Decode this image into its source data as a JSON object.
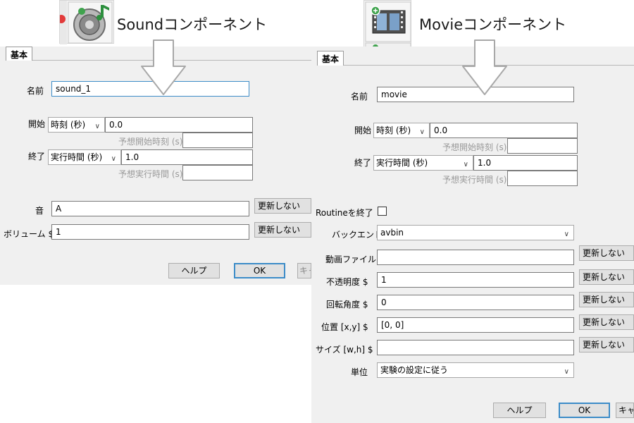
{
  "sound": {
    "title": "Soundコンポーネント",
    "tab": "基本",
    "name_label": "名前",
    "name_value": "sound_1",
    "start_label": "開始",
    "start_type": "時刻 (秒)",
    "start_value": "0.0",
    "expected_start_label": "予想開始時刻 (s)",
    "stop_label": "終了",
    "stop_type": "実行時間 (秒)",
    "stop_value": "1.0",
    "expected_duration_label": "予想実行時間 (s)",
    "sound_label": "音",
    "sound_value": "A",
    "sound_update": "更新しない",
    "volume_label": "ボリューム $",
    "volume_value": "1",
    "volume_update": "更新しない",
    "help_button": "ヘルプ",
    "ok_button": "OK",
    "cancel_button": "キャ"
  },
  "movie": {
    "title": "Movieコンポーネント",
    "tab": "基本",
    "name_label": "名前",
    "name_value": "movie",
    "start_label": "開始",
    "start_type": "時刻 (秒)",
    "start_value": "0.0",
    "expected_start_label": "予想開始時刻 (s)",
    "stop_label": "終了",
    "stop_type": "実行時間 (秒)",
    "stop_value": "1.0",
    "expected_duration_label": "予想実行時間 (s)",
    "force_end_label": "Routineを終了",
    "backend_label": "バックエンド",
    "backend_value": "avbin",
    "movie_file_label": "動画ファイル",
    "movie_file_value": "",
    "movie_file_update": "更新しない",
    "opacity_label": "不透明度 $",
    "opacity_value": "1",
    "opacity_update": "更新しない",
    "orientation_label": "回転角度 $",
    "orientation_value": "0",
    "orientation_update": "更新しない",
    "position_label": "位置 [x,y] $",
    "position_value": "[0, 0]",
    "position_update": "更新しない",
    "size_label": "サイズ [w,h] $",
    "size_value": "",
    "size_update": "更新しない",
    "units_label": "単位",
    "units_value": "実験の設定に従う",
    "help_button": "ヘルプ",
    "ok_button": "OK",
    "cancel_button": "キャ"
  },
  "colors": {
    "panel_bg": "#f0f0f0",
    "focus_border": "#3c8cc8",
    "button_bg": "#e1e1e1"
  }
}
